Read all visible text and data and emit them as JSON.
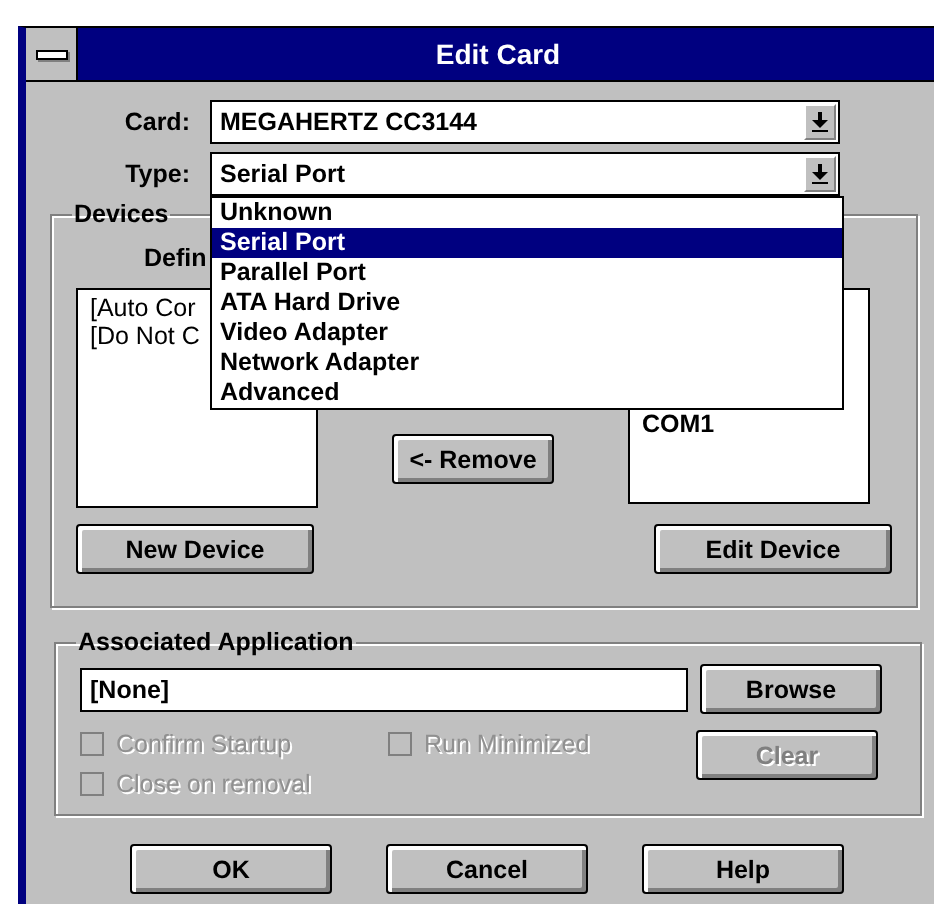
{
  "window": {
    "title": "Edit Card"
  },
  "card": {
    "label": "Card:",
    "value": "MEGAHERTZ CC3144"
  },
  "type": {
    "label": "Type:",
    "value": "Serial Port",
    "expanded": true,
    "options": [
      {
        "label": "Unknown",
        "selected": false
      },
      {
        "label": "Serial Port",
        "selected": true
      },
      {
        "label": "Parallel Port",
        "selected": false
      },
      {
        "label": "ATA Hard Drive",
        "selected": false
      },
      {
        "label": "Video Adapter",
        "selected": false
      },
      {
        "label": "Network Adapter",
        "selected": false
      },
      {
        "label": "Advanced",
        "selected": false
      }
    ]
  },
  "devices": {
    "title": "Devices",
    "list_label": {
      "text": "Defin"
    },
    "left_items": [
      "[Auto Cor",
      "[Do Not C"
    ],
    "right_items": [
      "COM1"
    ],
    "remove_button": {
      "label": "<- Remove"
    },
    "new_button": {
      "label": "New Device"
    },
    "edit_button": {
      "label": "Edit Device"
    }
  },
  "application": {
    "title": "Associated Application",
    "value": "[None]",
    "browse_button": {
      "label": "Browse"
    },
    "clear_button": {
      "label": "Clear",
      "disabled": true
    },
    "checkboxes": [
      {
        "label": "Confirm Startup",
        "checked": false,
        "disabled": true
      },
      {
        "label": "Run Minimized",
        "checked": false,
        "disabled": true
      },
      {
        "label": "Close on removal",
        "checked": false,
        "disabled": true
      }
    ]
  },
  "buttons": [
    {
      "label": "OK"
    },
    {
      "label": "Cancel"
    },
    {
      "label": "Help"
    }
  ]
}
